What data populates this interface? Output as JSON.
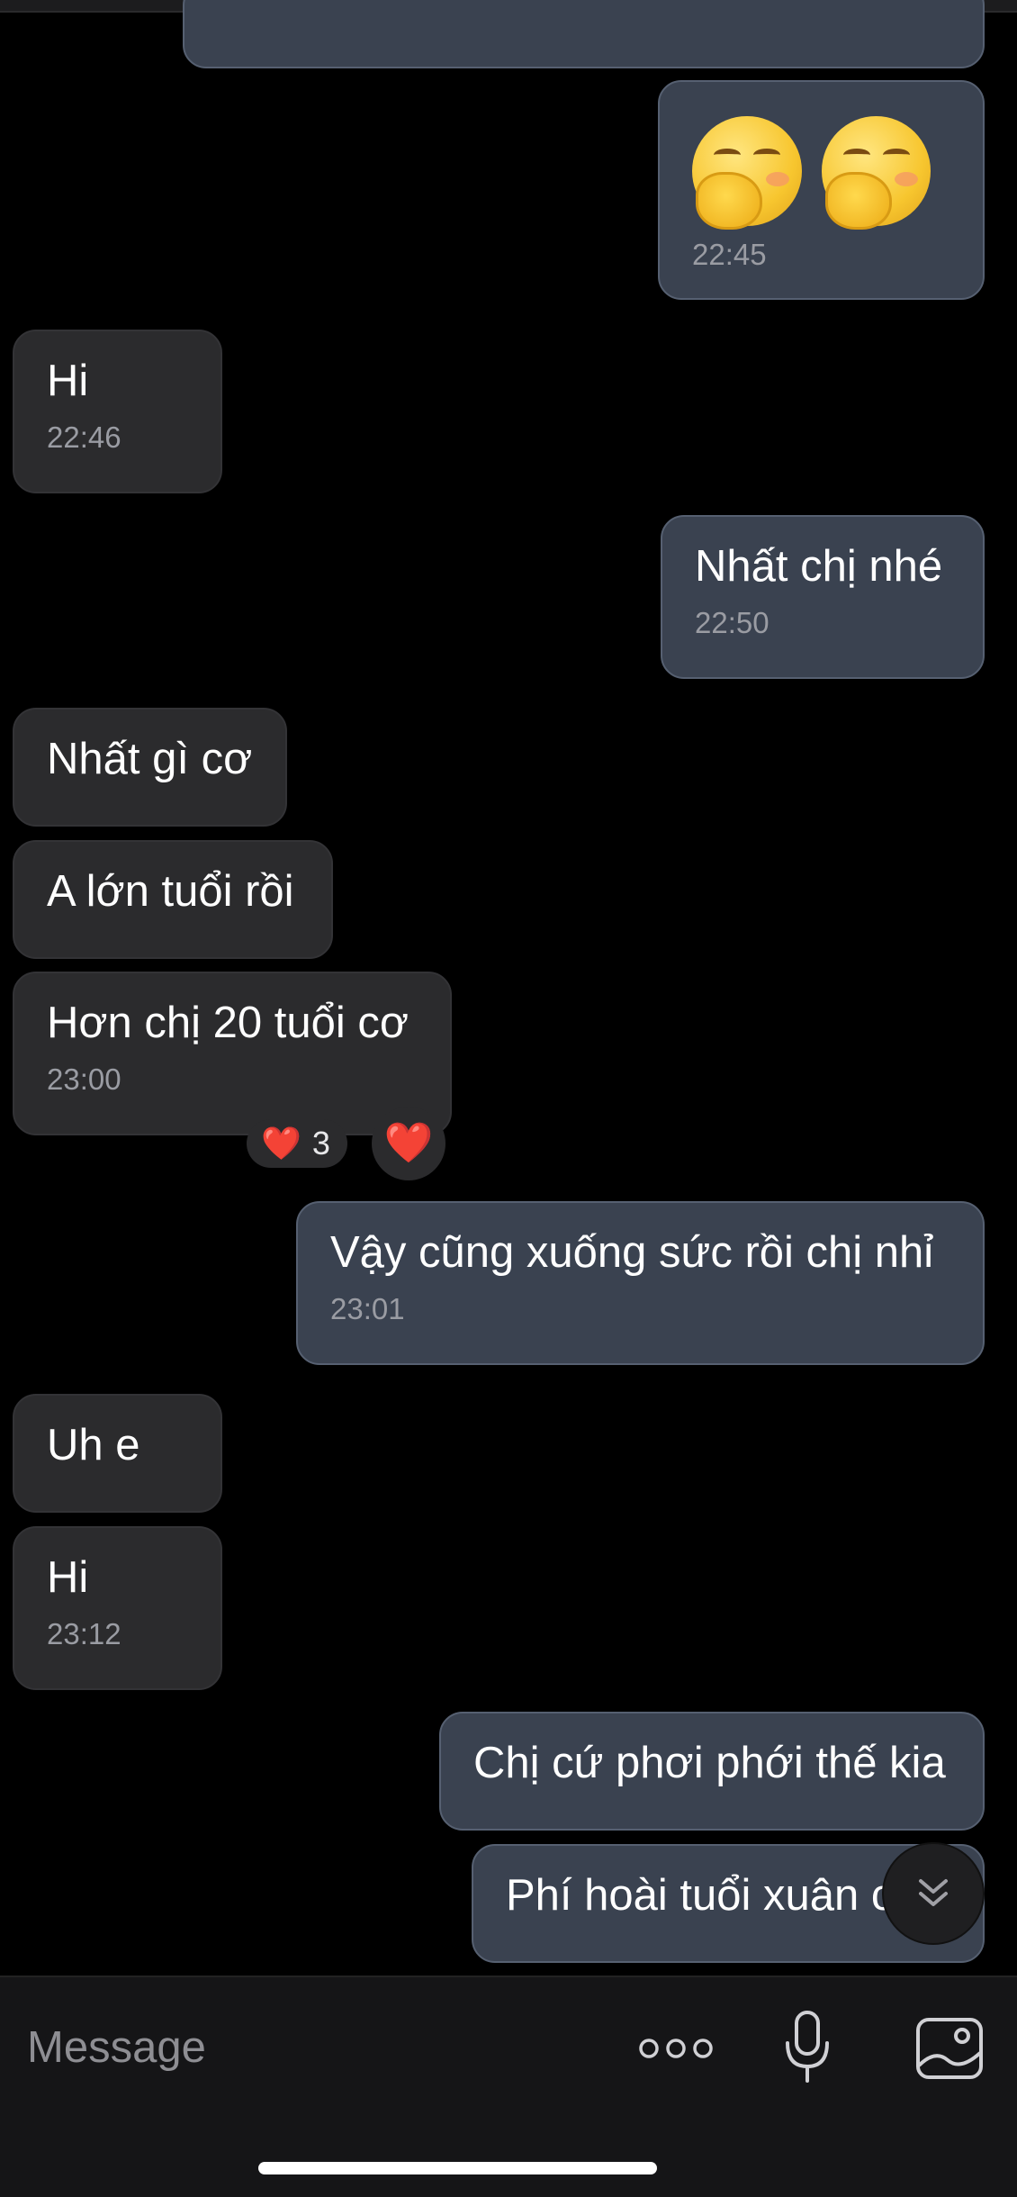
{
  "messages": [
    {
      "id": "m1",
      "direction": "sent",
      "emoji_count": 2,
      "emoji_name": "face-with-hand-over-mouth",
      "time": "22:45"
    },
    {
      "id": "m2",
      "direction": "received",
      "text": "Hi",
      "time": "22:46"
    },
    {
      "id": "m3",
      "direction": "sent",
      "text": "Nhất chị nhé",
      "time": "22:50"
    },
    {
      "id": "m4",
      "direction": "received",
      "text": "Nhất gì cơ"
    },
    {
      "id": "m5",
      "direction": "received",
      "text": "A lớn tuổi rồi"
    },
    {
      "id": "m6",
      "direction": "received",
      "text": "Hơn chị 20 tuổi cơ",
      "time": "23:00",
      "reactions": {
        "count_emoji": "❤️",
        "count": "3",
        "mine": "❤️"
      }
    },
    {
      "id": "m7",
      "direction": "sent",
      "text": "Vậy cũng xuống sức rồi chị nhỉ",
      "time": "23:01"
    },
    {
      "id": "m8",
      "direction": "received",
      "text": "Uh e"
    },
    {
      "id": "m9",
      "direction": "received",
      "text": "Hi",
      "time": "23:12"
    },
    {
      "id": "m10",
      "direction": "sent",
      "text": "Chị cứ phơi phới thế kia"
    },
    {
      "id": "m11",
      "direction": "sent",
      "text": "Phí hoài tuổi xuân c"
    }
  ],
  "composer": {
    "placeholder": "Message",
    "icons": [
      "more-icon",
      "microphone-icon",
      "gallery-icon"
    ]
  },
  "scroll_button_icon": "double-chevron-down-icon",
  "colors": {
    "background": "#000000",
    "received_bubble": "#2b2b2d",
    "sent_bubble": "#3a4250",
    "sent_border": "#566071",
    "timestamp": "#9a9ca3",
    "heart": "#e63946"
  }
}
